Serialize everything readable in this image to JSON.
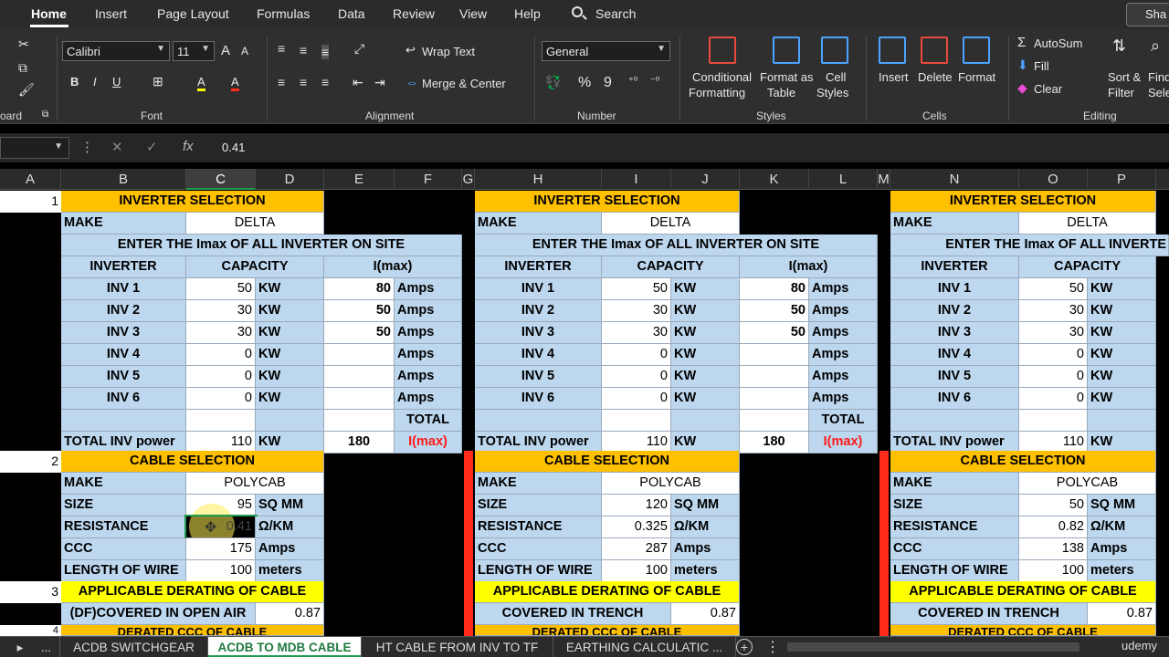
{
  "menu": {
    "home": "Home",
    "insert": "Insert",
    "page_layout": "Page Layout",
    "formulas": "Formulas",
    "data": "Data",
    "review": "Review",
    "view": "View",
    "help": "Help",
    "search": "Search",
    "share": "Sha"
  },
  "ribbon": {
    "clipboard_group": "oard",
    "font_name": "Calibri",
    "font_size": "11",
    "font_grow": "A",
    "font_shrink": "A",
    "bold": "B",
    "italic": "I",
    "underline": "U",
    "font_color_glyph": "A",
    "highlight_glyph": "A",
    "font_group": "Font",
    "wrap_text": "Wrap Text",
    "merge_center": "Merge & Center",
    "alignment_group": "Alignment",
    "number_format": "General",
    "percent": "%",
    "comma": "9",
    "number_group": "Number",
    "cond_fmt_1": "Conditional",
    "cond_fmt_2": "Formatting",
    "format_table_1": "Format as",
    "format_table_2": "Table",
    "cell_styles_1": "Cell",
    "cell_styles_2": "Styles",
    "styles_group": "Styles",
    "insert": "Insert",
    "delete": "Delete",
    "format": "Format",
    "cells_group": "Cells",
    "autosum": "AutoSum",
    "fill": "Fill",
    "clear": "Clear",
    "sort_filter_1": "Sort &",
    "sort_filter_2": "Filter",
    "find_1": "Find",
    "find_2": "Sele",
    "editing_group": "Editing"
  },
  "formula_bar": {
    "cancel": "✕",
    "enter": "✓",
    "fx": "fx",
    "value": "0.41"
  },
  "columns": [
    "A",
    "B",
    "C",
    "D",
    "E",
    "F",
    "G",
    "H",
    "I",
    "J",
    "K",
    "L",
    "M",
    "N",
    "O",
    "P"
  ],
  "rows": {
    "r1": "1",
    "r2": "2",
    "r3": "3",
    "r4": "4"
  },
  "left": {
    "title": "INVERTER  SELECTION",
    "make_label": "MAKE",
    "make": "DELTA",
    "imax_header": "ENTER THE Imax OF ALL INVERTER ON SITE",
    "h_inv": "INVERTER",
    "h_cap": "CAPACITY",
    "h_imax": "I(max)",
    "invs": [
      {
        "name": "INV 1",
        "cap": "50",
        "unit": "KW",
        "imax": "80",
        "amps": "Amps"
      },
      {
        "name": "INV 2",
        "cap": "30",
        "unit": "KW",
        "imax": "50",
        "amps": "Amps"
      },
      {
        "name": "INV 3",
        "cap": "30",
        "unit": "KW",
        "imax": "50",
        "amps": "Amps"
      },
      {
        "name": "INV 4",
        "cap": "0",
        "unit": "KW",
        "imax": "",
        "amps": "Amps"
      },
      {
        "name": "INV 5",
        "cap": "0",
        "unit": "KW",
        "imax": "",
        "amps": "Amps"
      },
      {
        "name": "INV 6",
        "cap": "0",
        "unit": "KW",
        "imax": "",
        "amps": "Amps"
      }
    ],
    "total_label": "TOTAL",
    "total_inv": "TOTAL INV power",
    "total_cap": "110",
    "total_unit": "KW",
    "total_imax": "180",
    "imax_red": "I(max)",
    "cable_title": "CABLE SELECTION",
    "cable": [
      {
        "label": "MAKE",
        "value": "POLYCAB",
        "unit": ""
      },
      {
        "label": "SIZE",
        "value": "95",
        "unit": "SQ MM"
      },
      {
        "label": "RESISTANCE",
        "value": "0.41",
        "unit": "Ω/KM"
      },
      {
        "label": "CCC",
        "value": "175",
        "unit": "Amps"
      },
      {
        "label": "LENGTH OF WIRE",
        "value": "100",
        "unit": "meters"
      }
    ],
    "derating_title": "APPLICABLE DERATING OF CABLE",
    "derating_label": "(DF)COVERED IN OPEN AIR",
    "derating_value": "0.87",
    "derated_ccc": "DERATED CCC OF CABLE"
  },
  "middle": {
    "title": "INVERTER  SELECTION",
    "make_label": "MAKE",
    "make": "DELTA",
    "imax_header": "ENTER THE Imax OF ALL INVERTER ON SITE",
    "h_inv": "INVERTER",
    "h_cap": "CAPACITY",
    "h_imax": "I(max)",
    "invs": [
      {
        "name": "INV 1",
        "cap": "50",
        "unit": "KW",
        "imax": "80",
        "amps": "Amps"
      },
      {
        "name": "INV 2",
        "cap": "30",
        "unit": "KW",
        "imax": "50",
        "amps": "Amps"
      },
      {
        "name": "INV 3",
        "cap": "30",
        "unit": "KW",
        "imax": "50",
        "amps": "Amps"
      },
      {
        "name": "INV 4",
        "cap": "0",
        "unit": "KW",
        "imax": "",
        "amps": "Amps"
      },
      {
        "name": "INV 5",
        "cap": "0",
        "unit": "KW",
        "imax": "",
        "amps": "Amps"
      },
      {
        "name": "INV 6",
        "cap": "0",
        "unit": "KW",
        "imax": "",
        "amps": "Amps"
      }
    ],
    "total_label": "TOTAL",
    "total_inv": "TOTAL INV power",
    "total_cap": "110",
    "total_unit": "KW",
    "total_imax": "180",
    "imax_red": "I(max)",
    "cable_title": "CABLE SELECTION",
    "cable": [
      {
        "label": "MAKE",
        "value": "POLYCAB",
        "unit": ""
      },
      {
        "label": "SIZE",
        "value": "120",
        "unit": "SQ MM"
      },
      {
        "label": "RESISTANCE",
        "value": "0.325",
        "unit": "Ω/KM"
      },
      {
        "label": "CCC",
        "value": "287",
        "unit": "Amps"
      },
      {
        "label": "LENGTH OF WIRE",
        "value": "100",
        "unit": "meters"
      }
    ],
    "derating_title": "APPLICABLE DERATING OF CABLE",
    "derating_label": "COVERED IN TRENCH",
    "derating_value": "0.87",
    "derated_ccc": "DERATED CCC OF CABLE"
  },
  "right": {
    "title": "INVERTER  SELECTION",
    "make_label": "MAKE",
    "make": "DELTA",
    "imax_header": "ENTER THE Imax OF ALL INVERTE",
    "h_inv": "INVERTER",
    "h_cap": "CAPACITY",
    "invs": [
      {
        "name": "INV 1",
        "cap": "50",
        "unit": "KW"
      },
      {
        "name": "INV 2",
        "cap": "30",
        "unit": "KW"
      },
      {
        "name": "INV 3",
        "cap": "30",
        "unit": "KW"
      },
      {
        "name": "INV 4",
        "cap": "0",
        "unit": "KW"
      },
      {
        "name": "INV 5",
        "cap": "0",
        "unit": "KW"
      },
      {
        "name": "INV 6",
        "cap": "0",
        "unit": "KW"
      }
    ],
    "total_inv": "TOTAL INV power",
    "total_cap": "110",
    "total_unit": "KW",
    "cable_title": "CABLE SELECTION",
    "cable": [
      {
        "label": "MAKE",
        "value": "POLYCAB",
        "unit": ""
      },
      {
        "label": "SIZE",
        "value": "50",
        "unit": "SQ MM"
      },
      {
        "label": "RESISTANCE",
        "value": "0.82",
        "unit": "Ω/KM"
      },
      {
        "label": "CCC",
        "value": "138",
        "unit": "Amps"
      },
      {
        "label": "LENGTH OF WIRE",
        "value": "100",
        "unit": "meters"
      }
    ],
    "derating_title": "APPLICABLE DERATING OF CABLE",
    "derating_label": "COVERED IN TRENCH",
    "derating_value": "0.87",
    "derated_ccc": "DERATED CCC OF CABLE"
  },
  "tabs": [
    "...",
    "ACDB SWITCHGEAR",
    "ACDB TO MDB CABLE",
    "HT CABLE FROM INV TO TF",
    "EARTHING CALCULATIC ..."
  ],
  "tab_add": "+",
  "watermark": "udemy",
  "colors": {
    "orange": "#ffc000",
    "blue": "#bdd7ee",
    "yellow": "#ffff00",
    "red": "#ff2a1a",
    "excel_green": "#1f9d55"
  }
}
